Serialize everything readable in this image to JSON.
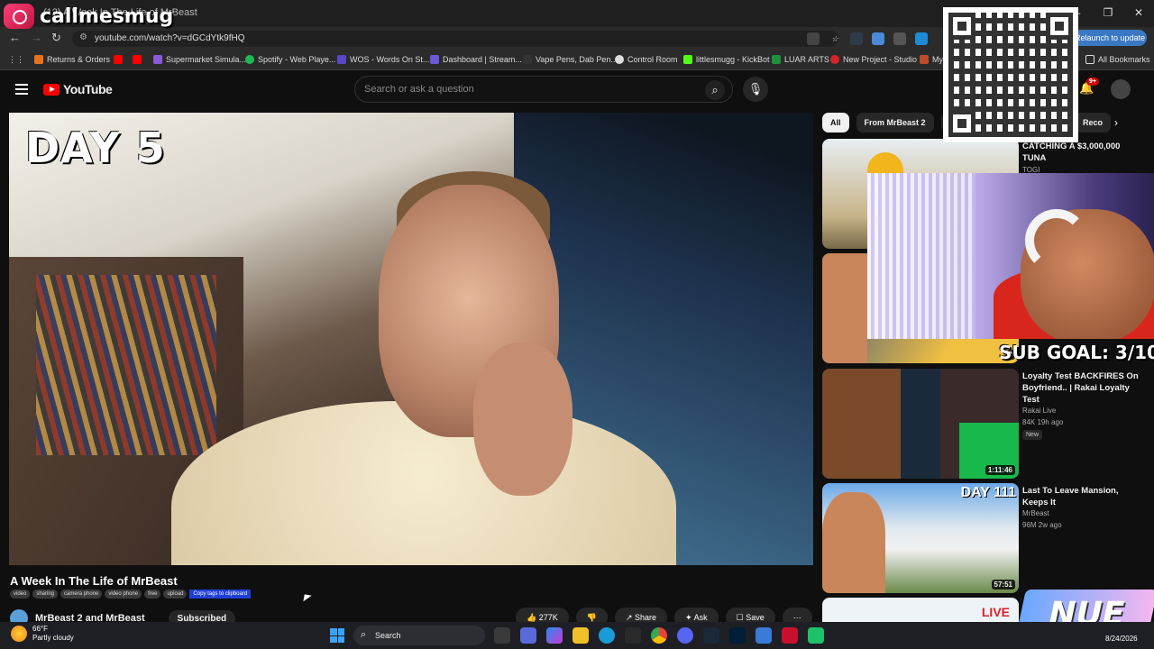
{
  "browser": {
    "tab_title": "(12) A Week In The Life of MrBeast",
    "url": "youtube.com/watch?v=dGCdYtk9fHQ",
    "update_label": "Relaunch to update",
    "bookmarks": [
      "Returns & Orders",
      "Supermarket Simula...",
      "Spotify - Web Playe...",
      "WOS - Words On St...",
      "Dashboard | Stream...",
      "Vape Pens, Dab Pen...",
      "Control Room",
      "littlesmugg - KickBot",
      "LUAR ARTS",
      "New Project - Studio",
      "My"
    ],
    "all_bookmarks": "All Bookmarks"
  },
  "overlay": {
    "brand": "callmesmug",
    "sub_goal": "SUB GOAL: 3/10",
    "logo_text": "NUE"
  },
  "youtube": {
    "logo": "YouTube",
    "search_placeholder": "Search or ask a question",
    "notification_count": "9+"
  },
  "video": {
    "overlay_text": "DAY 5",
    "title": "A Week In The Life of MrBeast",
    "tags": [
      "video",
      "sharing",
      "camera phone",
      "video phone",
      "free",
      "upload"
    ],
    "copy_tags": "Copy tags to clipboard",
    "channel": "MrBeast 2 and MrBeast",
    "subscribe": "Subscribed",
    "likes": "277K",
    "share": "Share",
    "ask": "Ask",
    "save": "Save"
  },
  "chips": [
    "All",
    "From MrBeast 2",
    "M",
    "Reco"
  ],
  "recommendations": [
    {
      "title": "CATCHING A $3,000,000 TUNA",
      "channel": "TOGI",
      "meta": "",
      "duration": "",
      "new": ""
    },
    {
      "title": "",
      "channel": "",
      "meta": "",
      "duration": "2",
      "new": ""
    },
    {
      "title": "Loyalty Test BACKFIRES On Boyfriend.. | Rakai Loyalty Test",
      "channel": "Rakai Live",
      "meta": "84K  19h ago",
      "duration": "1:11:46",
      "new": "New"
    },
    {
      "title": "Last To Leave Mansion, Keeps It",
      "channel": "MrBeast",
      "meta": "96M  2w ago",
      "duration": "57:51",
      "thumb_text": "DAY 111",
      "new": ""
    },
    {
      "title": "",
      "channel": "",
      "meta": "",
      "duration": "",
      "thumb_text": "LIVE",
      "new": ""
    }
  ],
  "taskbar": {
    "temp": "66°F",
    "condition": "Partly cloudy",
    "search": "Search",
    "date": "8/24/2026"
  }
}
